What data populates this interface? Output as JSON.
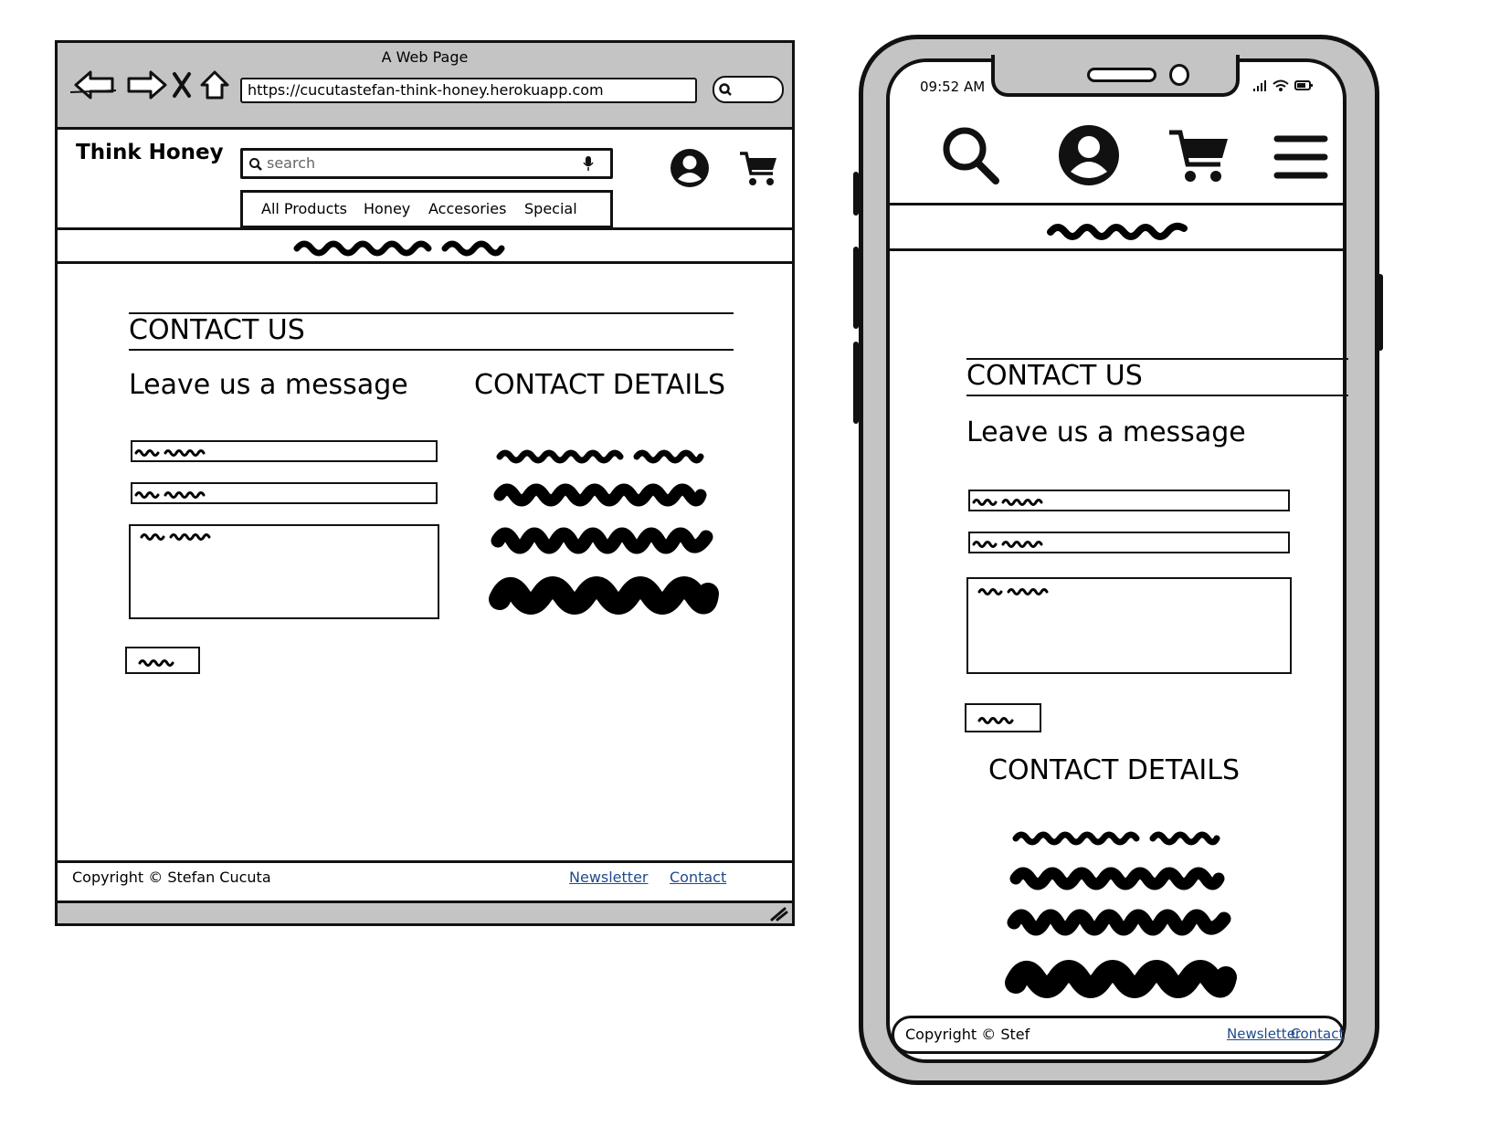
{
  "desktop": {
    "window_title": "A Web Page",
    "url": "https://cucutastefan-think-honey.herokuapp.com",
    "brand": "Think Honey",
    "search_placeholder": "search",
    "nav": [
      "All Products",
      "Honey",
      "Accesories",
      "Special"
    ],
    "contact_heading": "CONTACT US",
    "leave_message": "Leave us a message",
    "contact_details": "CONTACT DETAILS",
    "footer": {
      "copyright": "Copyright © Stefan Cucuta",
      "links": [
        "Newsletter",
        "Contact"
      ]
    }
  },
  "mobile": {
    "status_time": "09:52 AM",
    "contact_heading": "CONTACT US",
    "leave_message": "Leave us a message",
    "contact_details": "CONTACT DETAILS",
    "footer": {
      "copyright": "Copyright © Stef",
      "links": [
        "Newsletter",
        "Contact"
      ]
    }
  },
  "icons": [
    "back-arrow-icon",
    "forward-arrow-icon",
    "close-icon",
    "home-icon",
    "search-icon",
    "microphone-icon",
    "user-icon",
    "cart-icon",
    "menu-icon",
    "signal-icon",
    "wifi-icon",
    "battery-icon",
    "resize-grip-icon"
  ]
}
